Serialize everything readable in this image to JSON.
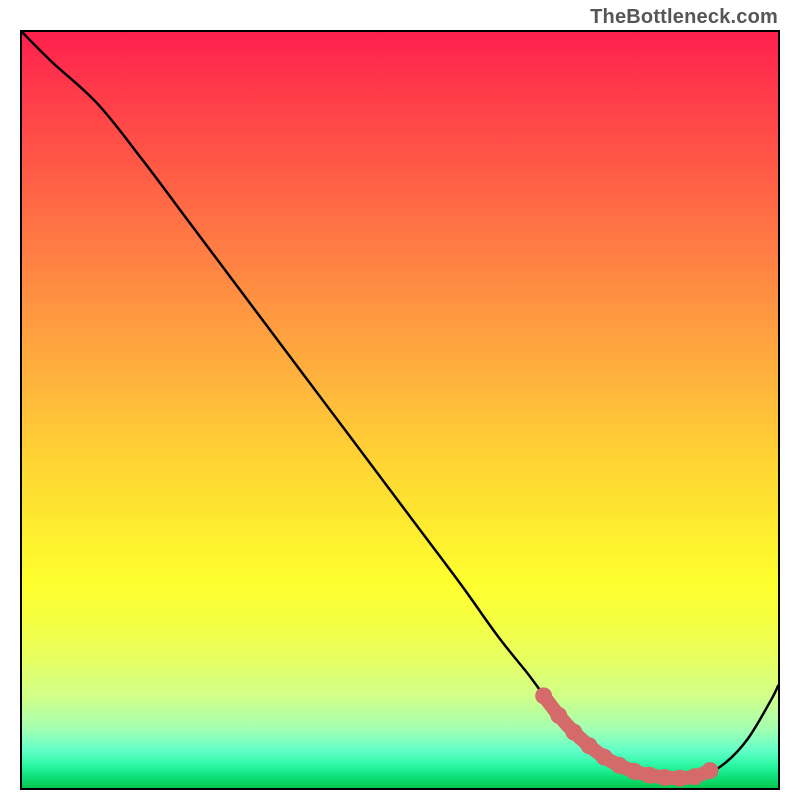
{
  "watermark": "TheBottleneck.com",
  "chart_data": {
    "type": "line",
    "title": "",
    "xlabel": "",
    "ylabel": "",
    "xlim": [
      0,
      100
    ],
    "ylim": [
      0,
      100
    ],
    "grid": false,
    "series": [
      {
        "name": "curve",
        "x": [
          0,
          4,
          10,
          16,
          22,
          28,
          34,
          40,
          46,
          52,
          58,
          63,
          67,
          70,
          73,
          76,
          79,
          82,
          85,
          87,
          90,
          93,
          96,
          99,
          100
        ],
        "y": [
          100,
          96,
          90.5,
          83,
          75,
          67,
          59,
          51,
          43,
          35,
          27,
          20,
          15,
          11,
          8,
          5.2,
          3.2,
          2,
          1.4,
          1.3,
          1.6,
          3.3,
          6.5,
          11.5,
          13.5
        ],
        "color": "#000000"
      },
      {
        "name": "highlight-segment",
        "x": [
          69,
          71,
          73,
          75,
          77,
          79,
          81,
          83,
          85,
          87,
          89,
          91
        ],
        "y": [
          12.2,
          9.6,
          7.4,
          5.6,
          4.1,
          3.0,
          2.2,
          1.7,
          1.4,
          1.3,
          1.5,
          2.3
        ],
        "color": "#d46a6a"
      }
    ],
    "background": "rainbow-vertical-gradient"
  }
}
